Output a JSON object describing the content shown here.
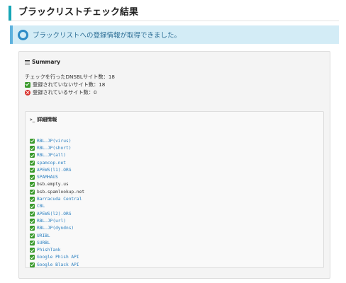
{
  "header": {
    "title": "ブラックリストチェック結果"
  },
  "notice": {
    "icon": "circle-info-icon",
    "message": "ブラックリストへの登録情報が取得できました。"
  },
  "summary": {
    "heading": "Summary",
    "total_label": "チェックを行ったDNSBLサイト数：18",
    "not_listed_label": "登録されていないサイト数：18",
    "listed_label": "登録されているサイト数：0",
    "not_listed_icon": "check-icon",
    "listed_icon": "x-circle-icon"
  },
  "details": {
    "heading": "詳細情報",
    "entries": [
      {
        "name": "RBL.JP(virus)",
        "link": true
      },
      {
        "name": "RBL.JP(short)",
        "link": true
      },
      {
        "name": "RBL.JP(all)",
        "link": true
      },
      {
        "name": "spamcop.net",
        "link": true
      },
      {
        "name": "APEWS(l1).ORG",
        "link": true
      },
      {
        "name": "SPAMHAUS",
        "link": true
      },
      {
        "name": "bsb.empty.us",
        "link": false
      },
      {
        "name": "bsb.spamlookup.net",
        "link": false
      },
      {
        "name": "Barracuda Central",
        "link": true
      },
      {
        "name": "CBL",
        "link": true
      },
      {
        "name": "APEWS(l2).ORG",
        "link": true
      },
      {
        "name": "RBL.JP(url)",
        "link": true
      },
      {
        "name": "RBL.JP(dyndns)",
        "link": true
      },
      {
        "name": "URIBL",
        "link": true
      },
      {
        "name": "SURBL",
        "link": true
      },
      {
        "name": "PhishTank",
        "link": true
      },
      {
        "name": "Google Phish API",
        "link": true
      },
      {
        "name": "Google Black API",
        "link": true
      }
    ]
  },
  "colors": {
    "accent": "#16a6b6",
    "notice_bg": "#d3ecf6",
    "link": "#2a7fc0",
    "check": "#3a9a2c",
    "error": "#d9332e"
  }
}
